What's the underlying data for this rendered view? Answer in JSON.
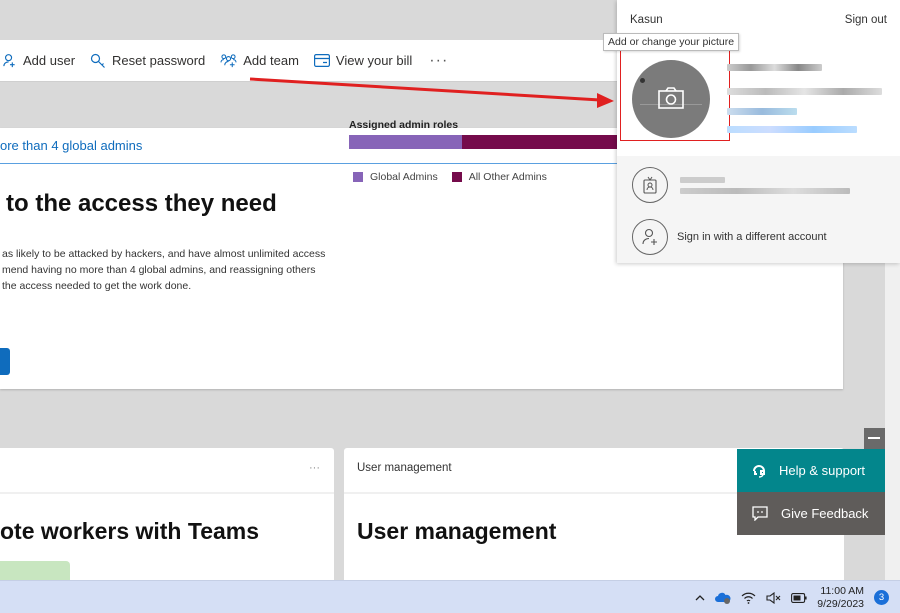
{
  "command_bar": {
    "items": [
      {
        "label": "Add user",
        "icon": "add-user-icon"
      },
      {
        "label": "Reset password",
        "icon": "key-icon"
      },
      {
        "label": "Add team",
        "icon": "add-team-icon"
      },
      {
        "label": "View your bill",
        "icon": "bill-icon"
      }
    ],
    "more_label": "···"
  },
  "admin_card": {
    "link": "ore than 4 global admins",
    "title": "to the access they need",
    "body": "as likely to be attacked by hackers, and have almost unlimited access mend having no more than 4 global admins, and reassigning others the access needed to get the work done."
  },
  "chart_data": {
    "type": "bar",
    "title": "Assigned admin roles",
    "stacked": true,
    "orientation": "horizontal",
    "series": [
      {
        "name": "Global Admins",
        "fraction": 0.236,
        "color": "#8764b8"
      },
      {
        "name": "All Other Admins",
        "fraction": 0.764,
        "color": "#750b4b"
      }
    ],
    "legend": "bottom-left"
  },
  "teams_card": {
    "more_label": "···",
    "title": "ote workers with Teams"
  },
  "user_mgmt_card": {
    "header": "User management",
    "title": "User management"
  },
  "profile_panel": {
    "name": "Kasun",
    "sign_out": "Sign out",
    "tooltip": "Add or change your picture",
    "other_account_row": {
      "icon": "badge-icon"
    },
    "sign_in_other": "Sign in with a different account"
  },
  "feedback_widget": {
    "help_label": "Help & support",
    "feedback_label": "Give Feedback"
  },
  "taskbar": {
    "time": "11:00 AM",
    "date": "9/29/2023",
    "notification_count": "3"
  },
  "colors": {
    "accent_blue": "#0f6cbd",
    "help_teal": "#03868c",
    "feedback_grey": "#5f5c5a",
    "annotation_red": "#e02020"
  }
}
